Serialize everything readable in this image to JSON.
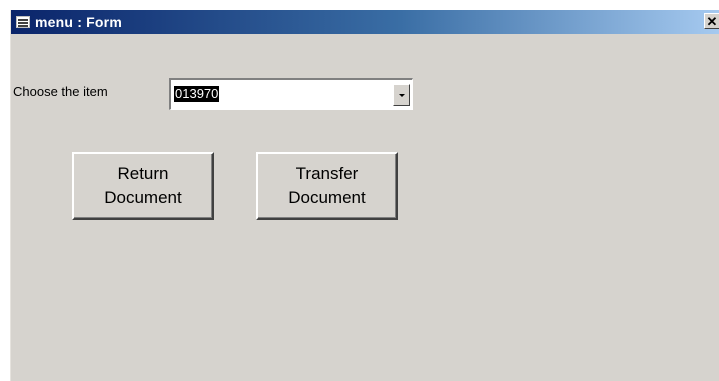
{
  "window": {
    "title": "menu : Form",
    "close_glyph": "✕",
    "app_icon": "form-icon"
  },
  "form": {
    "choose_label": "Choose the item",
    "item_combo": {
      "value": "013970",
      "dropdown_icon": "chevron-down-icon"
    },
    "buttons": {
      "return_label": "Return\nDocument",
      "transfer_label": "Transfer\nDocument"
    }
  },
  "colors": {
    "form_background": "#d6d3ce",
    "title_gradient_start": "#0a246a",
    "title_gradient_end": "#a6caf0",
    "selection": "#000000"
  }
}
